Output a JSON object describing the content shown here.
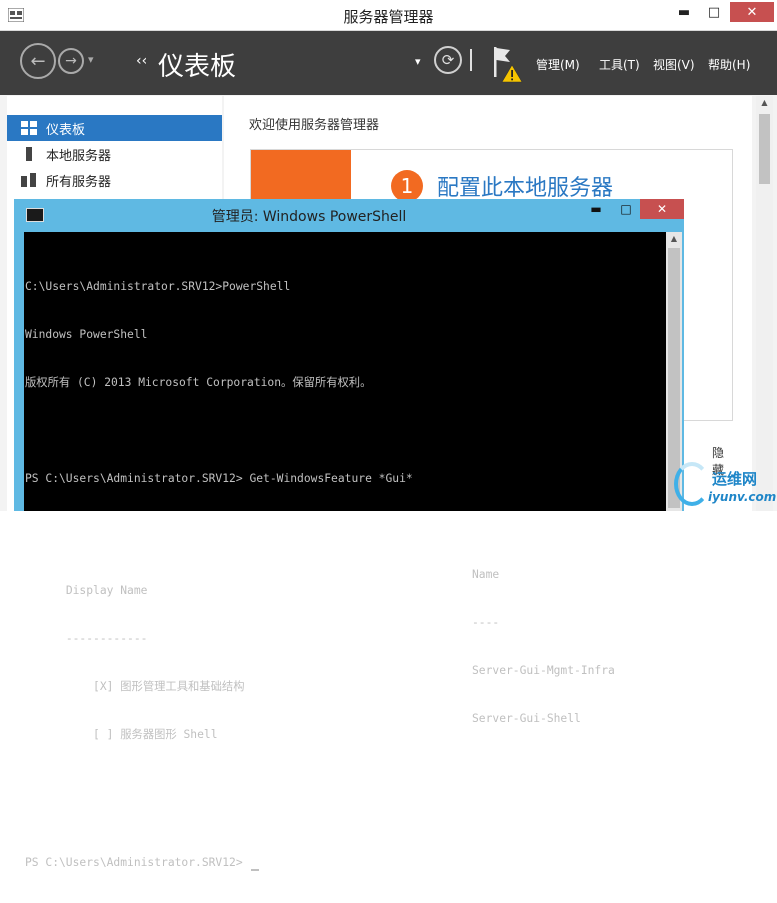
{
  "server_manager": {
    "title": "服务器管理器",
    "window_buttons": {
      "minimize": "▬",
      "maximize": "□",
      "close": "✕"
    },
    "breadcrumb_arrows": "‹‹",
    "breadcrumb_title": "仪表板",
    "dropdown_glyph": "▾",
    "refresh_glyph": "⟳",
    "menu": [
      "管理(M)",
      "工具(T)",
      "视图(V)",
      "帮助(H)"
    ],
    "sidebar": [
      {
        "label": "仪表板",
        "icon": "dashboard-icon",
        "active": true
      },
      {
        "label": "本地服务器",
        "icon": "local-server-icon",
        "active": false
      },
      {
        "label": "所有服务器",
        "icon": "all-servers-icon",
        "active": false
      }
    ],
    "welcome": "欢迎使用服务器管理器",
    "step_number": "1",
    "step_text": "配置此本地服务器",
    "hide_fragment": "隐藏",
    "accent_color": "#2a78c3",
    "orange_color": "#f26a21"
  },
  "powershell": {
    "title": "管理员: Windows PowerShell",
    "window_buttons": {
      "minimize": "▬",
      "maximize": "□",
      "close": "✕"
    },
    "lines": [
      "C:\\Users\\Administrator.SRV12>PowerShell",
      "Windows PowerShell",
      "版权所有 (C) 2013 Microsoft Corporation。保留所有权利。",
      "",
      "PS C:\\Users\\Administrator.SRV12> Get-WindowsFeature *Gui*",
      ""
    ],
    "table": {
      "header": {
        "display": "Display Name",
        "name": "Name"
      },
      "divider": {
        "display": "------------",
        "name": "----"
      },
      "rows": [
        {
          "display": "    [X] 图形管理工具和基础结构",
          "name": "Server-Gui-Mgmt-Infra"
        },
        {
          "display": "    [ ] 服务器图形 Shell",
          "name": "Server-Gui-Shell"
        }
      ]
    },
    "prompt": "PS C:\\Users\\Administrator.SRV12> "
  },
  "watermark": {
    "cn": "运维网",
    "url": "iyunv.com"
  }
}
